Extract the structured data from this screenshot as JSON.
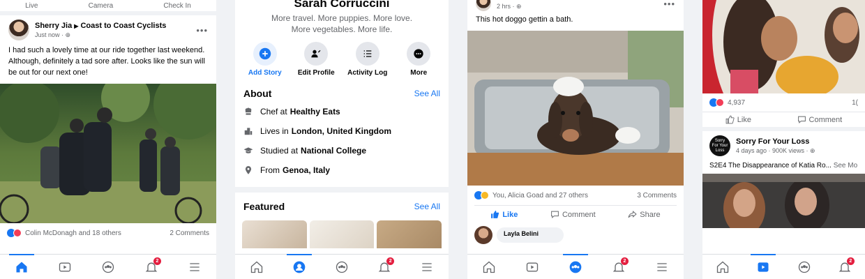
{
  "phone1": {
    "top_bar": [
      "Live",
      "Camera",
      "Check In"
    ],
    "post": {
      "author": "Sherry Jia",
      "group": "Coast to Coast Cyclists",
      "time": "Just now · ⊕",
      "text": "I had such a lovely time at our ride together last weekend. Although, definitely a tad sore after. Looks like the sun will be out for our next one!",
      "reactions_text": "Colin McDonagh and 18 others",
      "comments": "2 Comments"
    },
    "nav_badge": "2"
  },
  "phone2": {
    "name": "Sarah Corruccini",
    "bio_line1": "More travel. More puppies. More love.",
    "bio_line2": "More vegetables. More life.",
    "actions": [
      "Add Story",
      "Edit Profile",
      "Activity Log",
      "More"
    ],
    "about_title": "About",
    "see_all": "See All",
    "about": [
      {
        "prefix": "Chef at",
        "bold": "Healthy Eats"
      },
      {
        "prefix": "Lives in",
        "bold": "London, United Kingdom"
      },
      {
        "prefix": "Studied at",
        "bold": "National College"
      },
      {
        "prefix": "From",
        "bold": "Genoa, Italy"
      }
    ],
    "featured_title": "Featured",
    "nav_badge": "2"
  },
  "phone3": {
    "time": "2 hrs · ⊕",
    "text": "This hot doggo gettin a bath.",
    "reactions_text": "You, Alicia Goad and 27 others",
    "comments": "3 Comments",
    "actions": [
      "Like",
      "Comment",
      "Share"
    ],
    "commenter": "Layla Belini",
    "nav_badge": "2"
  },
  "phone4": {
    "reaction_count": "4,937",
    "reaction_right": "1(",
    "actions": [
      "Like",
      "Comment"
    ],
    "video_title": "Sorry For Your Loss",
    "video_meta": "4 days ago · 900K views · ⊕",
    "video_logo": "Sorry For Your Loss",
    "episode": "S2E4 The Disappearance of Katia Ro...",
    "see_more": "See Mo",
    "nav_badge": "2"
  },
  "colors": {
    "brand": "#1877f2",
    "badge": "#e41e3f",
    "love": "#f33e58"
  }
}
